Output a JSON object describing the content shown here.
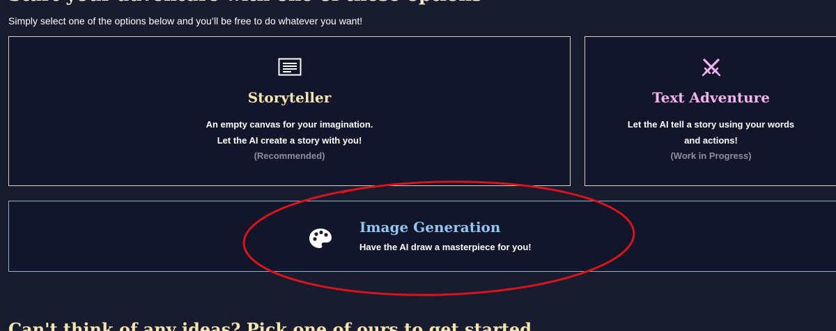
{
  "header": {
    "heading": "Start your adventure with one of these options",
    "subtitle": "Simply select one of the options below and you’ll be free to do whatever you want!"
  },
  "modes": {
    "storyteller": {
      "icon": "document-lines-icon",
      "title": "Storyteller",
      "desc_line1": "An empty canvas for your imagination.",
      "desc_line2": "Let the AI create a story with you!",
      "note": "(Recommended)"
    },
    "text_adventure": {
      "icon": "crossed-swords-icon",
      "title": "Text Adventure",
      "desc_line1": "Let the AI tell a story using your words",
      "desc_line2": "and actions!",
      "note": "(Work in Progress)"
    },
    "image_generation": {
      "icon": "palette-icon",
      "title": "Image Generation",
      "desc": "Have the AI draw a masterpiece for you!"
    }
  },
  "ideas": {
    "heading": "Can't think of any ideas? Pick one of ours to get started"
  },
  "colors": {
    "background": "#191b2f",
    "card_background": "#13152a",
    "storyteller_title": "#f4e6b0",
    "adventure_title": "#f1b3ef",
    "image_title": "#8fc6f2",
    "annotation_ellipse": "#d8141c"
  }
}
